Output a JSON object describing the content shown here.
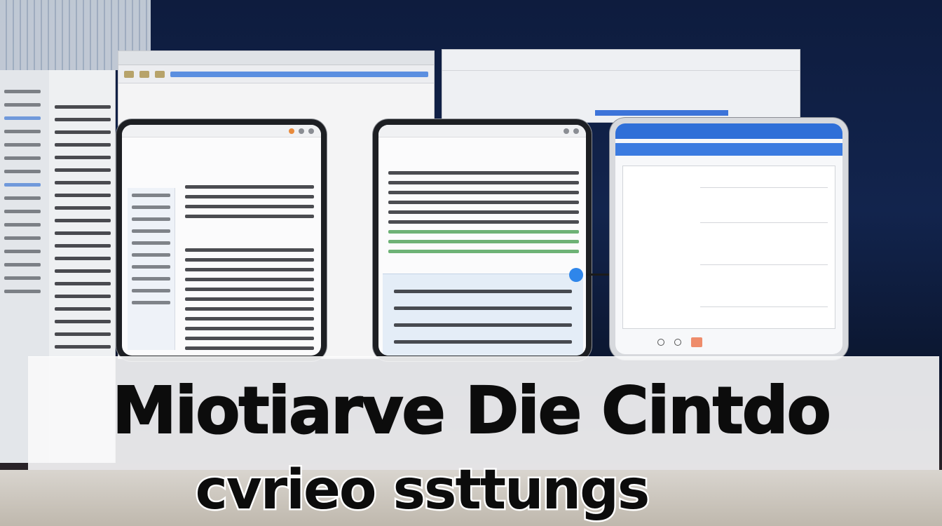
{
  "headline": {
    "line1": "Miotiarve Die Cintdo",
    "line2": "cvrieo ssttungs"
  },
  "colors": {
    "background": "#0e1c3e",
    "accent_blue": "#2f86ea",
    "appbar_blue": "#2f6fd8",
    "headline_text": "#0c0c0c"
  },
  "icons": [
    "connector-handle-icon",
    "status-dot-icon"
  ]
}
